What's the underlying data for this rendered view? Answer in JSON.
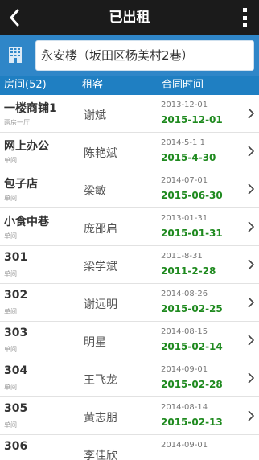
{
  "titlebar": {
    "title": "已出租",
    "back_icon": "back-icon",
    "more_icon": "more-vert-icon"
  },
  "building": {
    "name": "永安楼（坂田区杨美村2巷）",
    "icon": "building-icon",
    "accent": "#2f86c8"
  },
  "table_header": {
    "room": "房间(52)",
    "tenant": "租客",
    "contract": "合同时间",
    "color": "#1f7fc2"
  },
  "rows": [
    {
      "room": "一楼商铺1",
      "type": "两房一厅",
      "tenant": "谢斌",
      "start": "2013-12-01",
      "end": "2015-12-01"
    },
    {
      "room": "网上办公",
      "type": "单间",
      "tenant": "陈艳斌",
      "start": "2014-5-1 1",
      "end": "2015-4-30"
    },
    {
      "room": "包子店",
      "type": "单间",
      "tenant": "梁敏",
      "start": "2014-07-01",
      "end": "2015-06-30"
    },
    {
      "room": "小食中巷",
      "type": "单间",
      "tenant": "庞邵启",
      "start": "2013-01-31",
      "end": "2015-01-31"
    },
    {
      "room": "301",
      "type": "单间",
      "tenant": "梁学斌",
      "start": "2011-8-31",
      "end": "2011-2-28"
    },
    {
      "room": "302",
      "type": "单间",
      "tenant": "谢远明",
      "start": "2014-08-26",
      "end": "2015-02-25"
    },
    {
      "room": "303",
      "type": "单间",
      "tenant": "明星",
      "start": "2014-08-15",
      "end": "2015-02-14"
    },
    {
      "room": "304",
      "type": "单间",
      "tenant": "王飞龙",
      "start": "2014-09-01",
      "end": "2015-02-28"
    },
    {
      "room": "305",
      "type": "单间",
      "tenant": "黄志朋",
      "start": "2014-08-14",
      "end": "2015-02-13"
    },
    {
      "room": "306",
      "type": "",
      "tenant": "李佳欣",
      "start": "2014-09-01",
      "end": ""
    }
  ],
  "colors": {
    "end_date": "#1f8a1f",
    "titlebar": "#1b1b1b"
  }
}
